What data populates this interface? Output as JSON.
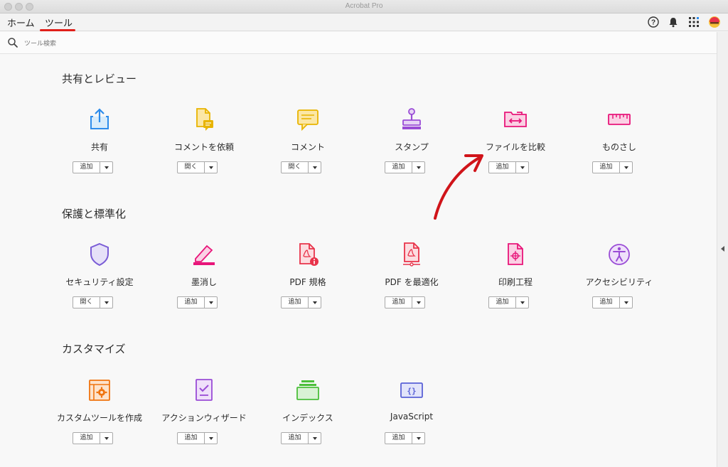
{
  "window": {
    "title": "Acrobat Pro"
  },
  "menu": {
    "tabs": [
      {
        "label": "ホーム"
      },
      {
        "label": "ツール"
      }
    ]
  },
  "search": {
    "placeholder": "ツール検索"
  },
  "colors": {
    "accent_red": "#e0201a",
    "share_blue": "#2d8ceb",
    "comment_yellow": "#e8b400",
    "purple": "#9a4cd6",
    "magenta": "#e8167a",
    "orange": "#f0740f",
    "green": "#4bbf3a",
    "indigo": "#5a62d6"
  },
  "sections": [
    {
      "title": "共有とレビュー",
      "tools": [
        {
          "label": "共有",
          "button": "追加",
          "icon": "share-icon"
        },
        {
          "label": "コメントを依頼",
          "button": "開く",
          "icon": "request-comment-icon"
        },
        {
          "label": "コメント",
          "button": "開く",
          "icon": "comment-icon"
        },
        {
          "label": "スタンプ",
          "button": "追加",
          "icon": "stamp-icon"
        },
        {
          "label": "ファイルを比較",
          "button": "追加",
          "icon": "compare-files-icon"
        },
        {
          "label": "ものさし",
          "button": "追加",
          "icon": "ruler-icon"
        }
      ]
    },
    {
      "title": "保護と標準化",
      "tools": [
        {
          "label": "セキュリティ設定",
          "button": "開く",
          "icon": "shield-icon"
        },
        {
          "label": "墨消し",
          "button": "追加",
          "icon": "redact-icon"
        },
        {
          "label": "PDF 規格",
          "button": "追加",
          "icon": "pdf-standards-icon"
        },
        {
          "label": "PDF を最適化",
          "button": "追加",
          "icon": "optimize-pdf-icon"
        },
        {
          "label": "印刷工程",
          "button": "追加",
          "icon": "print-production-icon"
        },
        {
          "label": "アクセシビリティ",
          "button": "追加",
          "icon": "accessibility-icon"
        }
      ]
    },
    {
      "title": "カスタマイズ",
      "tools": [
        {
          "label": "カスタムツールを作成",
          "button": "追加",
          "icon": "custom-tool-icon"
        },
        {
          "label": "アクションウィザード",
          "button": "追加",
          "icon": "action-wizard-icon"
        },
        {
          "label": "インデックス",
          "button": "追加",
          "icon": "index-icon"
        },
        {
          "label": "JavaScript",
          "button": "追加",
          "icon": "javascript-icon"
        }
      ]
    }
  ]
}
